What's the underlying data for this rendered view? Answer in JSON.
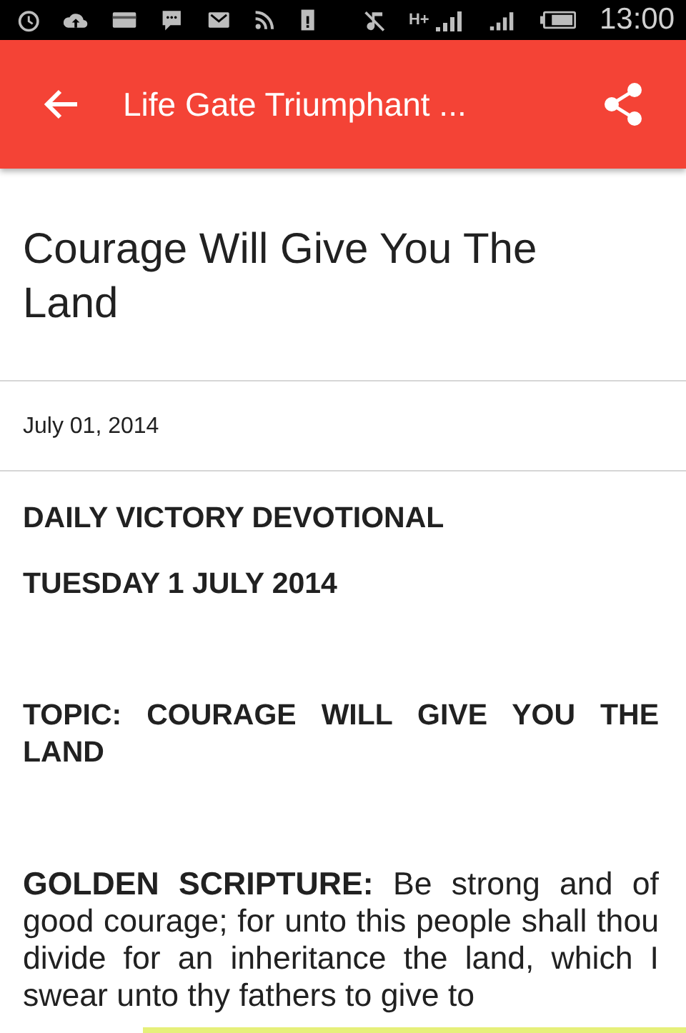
{
  "status_bar": {
    "network_type": "H+",
    "time": "13:00"
  },
  "app_bar": {
    "title": "Life Gate Triumphant ..."
  },
  "article": {
    "title": "Courage Will Give You The Land",
    "date": "July 01, 2014",
    "blocks": [
      {
        "kind": "heading",
        "text": "DAILY VICTORY DEVOTIONAL"
      },
      {
        "kind": "heading",
        "text": "TUESDAY 1 JULY 2014"
      },
      {
        "kind": "gap"
      },
      {
        "kind": "heading",
        "text": "TOPIC: COURAGE WILL GIVE YOU THE LAND"
      },
      {
        "kind": "gap"
      },
      {
        "kind": "body",
        "text": "**GOLDEN SCRIPTURE:** Be strong and of good courage; for unto this people shall thou divide for an inheritance the land, which I swear unto thy fathers to give to"
      }
    ]
  }
}
